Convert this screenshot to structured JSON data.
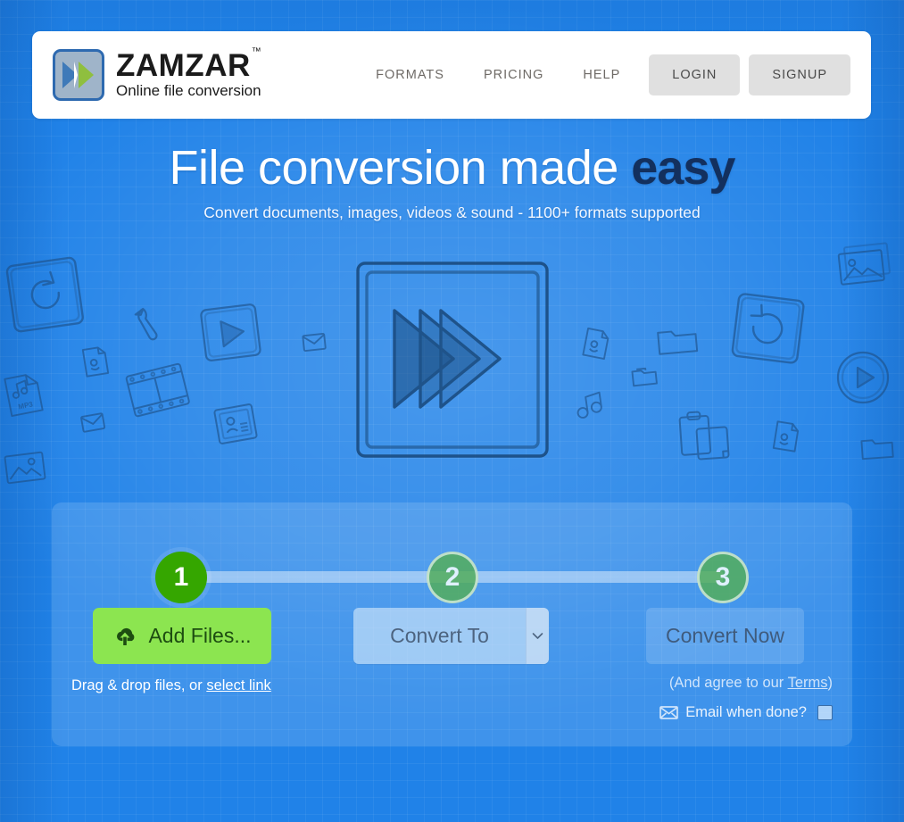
{
  "header": {
    "logo_icon": "zamzar-fastforward-logo",
    "brand_name": "ZAMZAR",
    "brand_tm": "™",
    "brand_tagline": "Online file conversion",
    "nav_links": [
      {
        "label": "FORMATS",
        "name": "nav-formats"
      },
      {
        "label": "PRICING",
        "name": "nav-pricing"
      },
      {
        "label": "HELP",
        "name": "nav-help"
      }
    ],
    "login_label": "LOGIN",
    "signup_label": "SIGNUP"
  },
  "hero": {
    "title_light": "File conversion made ",
    "title_accent": "easy",
    "subtitle": "Convert documents, images, videos & sound - 1100+ formats supported"
  },
  "illustration": {
    "center_icon": "fast-forward-sketch",
    "scattered_icons": [
      "refresh-sketch-icon",
      "wrench-sketch-icon",
      "play-square-sketch-icon",
      "envelope-sketch-icon",
      "document-sketch-icon",
      "mp3-file-sketch-icon",
      "film-strip-sketch-icon",
      "image-file-sketch-icon",
      "contact-card-sketch-icon",
      "folder-sketch-icon",
      "music-note-sketch-icon",
      "clipboard-sketch-icon",
      "play-circle-sketch-icon",
      "photos-sketch-icon"
    ]
  },
  "converter": {
    "steps": [
      {
        "number": "1",
        "state": "active"
      },
      {
        "number": "2",
        "state": "inactive"
      },
      {
        "number": "3",
        "state": "inactive"
      }
    ],
    "add_files_label": "Add Files...",
    "add_files_icon": "cloud-upload-icon",
    "convert_to_label": "Convert To",
    "convert_to_caret_icon": "chevron-down-icon",
    "convert_now_label": "Convert Now",
    "drag_note_prefix": "Drag & drop files, or ",
    "drag_note_link": "select link",
    "terms_prefix": "(And agree to our ",
    "terms_link": "Terms",
    "terms_suffix": ")",
    "email_icon": "envelope-icon",
    "email_label": "Email when done?",
    "email_checked": false
  },
  "colors": {
    "page_blue": "#2082e8",
    "accent_green": "#8ce550",
    "step_active_green": "#35a600",
    "title_accent_navy": "#13305e",
    "nav_button_gray": "#e0e0e0"
  }
}
